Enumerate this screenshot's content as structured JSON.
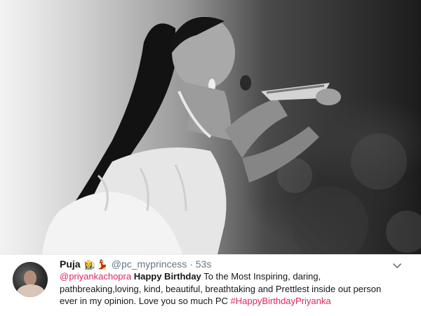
{
  "tweet": {
    "display_name": "Puja",
    "emojis": [
      "👩‍🌾",
      "💃"
    ],
    "handle": "@pc_myprincess",
    "separator": "·",
    "time": "53s",
    "mention": "@priyankachopra",
    "bold_text": "Happy Birthday",
    "text_line1_rest": "To the Most Inspiring, daring,",
    "text_line2": "pathbreaking,loving, kind, beautiful, breathtaking and Prettlest inside out person",
    "text_line3": "ever in my opinion.  Love you so much PC",
    "hashtag": "#HappyBirthdayPriyanka"
  },
  "colors": {
    "accent": "#e0245e",
    "text": "#14171a",
    "muted": "#657786"
  },
  "icons": {
    "menu": "chevron-down-icon"
  }
}
